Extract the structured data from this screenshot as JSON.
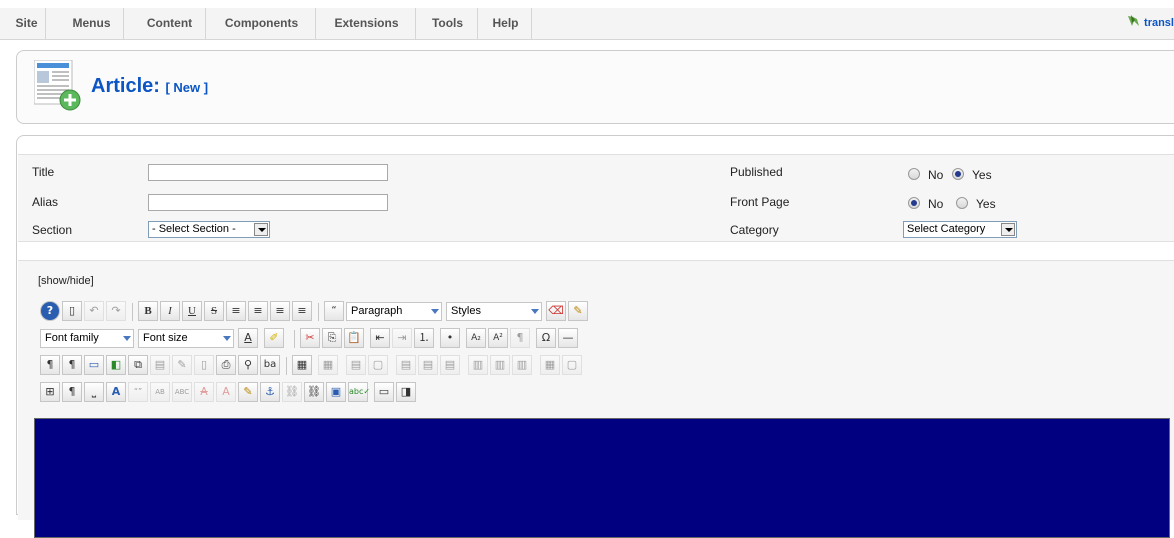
{
  "menu": {
    "items": [
      "Site",
      "Menus",
      "Content",
      "Components",
      "Extensions",
      "Tools",
      "Help"
    ],
    "right_link": "transl"
  },
  "header": {
    "title": "Article:",
    "subtitle": "[ New ]"
  },
  "form": {
    "title_label": "Title",
    "alias_label": "Alias",
    "section_label": "Section",
    "section_value": "- Select Section -",
    "published_label": "Published",
    "frontpage_label": "Front Page",
    "category_label": "Category",
    "category_value": "Select Category",
    "no_label": "No",
    "yes_label": "Yes",
    "published_selected": "Yes",
    "frontpage_selected": "No"
  },
  "editor": {
    "toggle_label": "[show/hide]",
    "format_select": "Paragraph",
    "styles_select": "Styles",
    "font_family_select": "Font family",
    "font_size_select": "Font size",
    "content_bg": "#000080"
  },
  "colors": {
    "accent": "#0B55C4"
  }
}
